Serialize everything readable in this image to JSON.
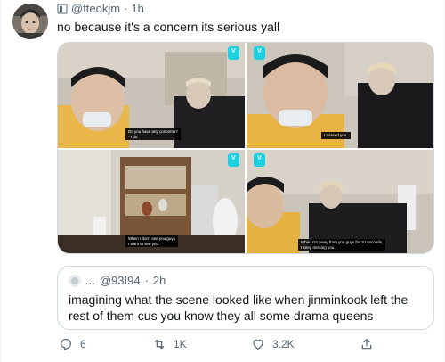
{
  "tweet": {
    "handle": "@tteokjm",
    "separator": "·",
    "time": "1h",
    "text": "no because it's a concern its serious yall"
  },
  "media": {
    "badge_label": "V",
    "captions": {
      "top_left": [
        "Do you have any concerns?",
        "- I do."
      ],
      "top_right": [
        "I missed you."
      ],
      "bottom_left": [
        "When I don't see you guys",
        "I want to see you."
      ],
      "bottom_right": [
        "When I'm away from you guys for 10 seconds,",
        "I keep missing you."
      ]
    }
  },
  "quote": {
    "dots": "...",
    "handle": "@93I94",
    "separator": "·",
    "time": "2h",
    "text": "imagining what the scene looked like when jinminkook left the rest of them cus you know they all some drama queens"
  },
  "actions": {
    "reply_count": "6",
    "retweet_count": "1K",
    "like_count": "3.2K"
  },
  "colors": {
    "text": "#0f1419",
    "secondary": "#536471",
    "border": "#cfd9de",
    "vlive": "#1ecfe0"
  }
}
